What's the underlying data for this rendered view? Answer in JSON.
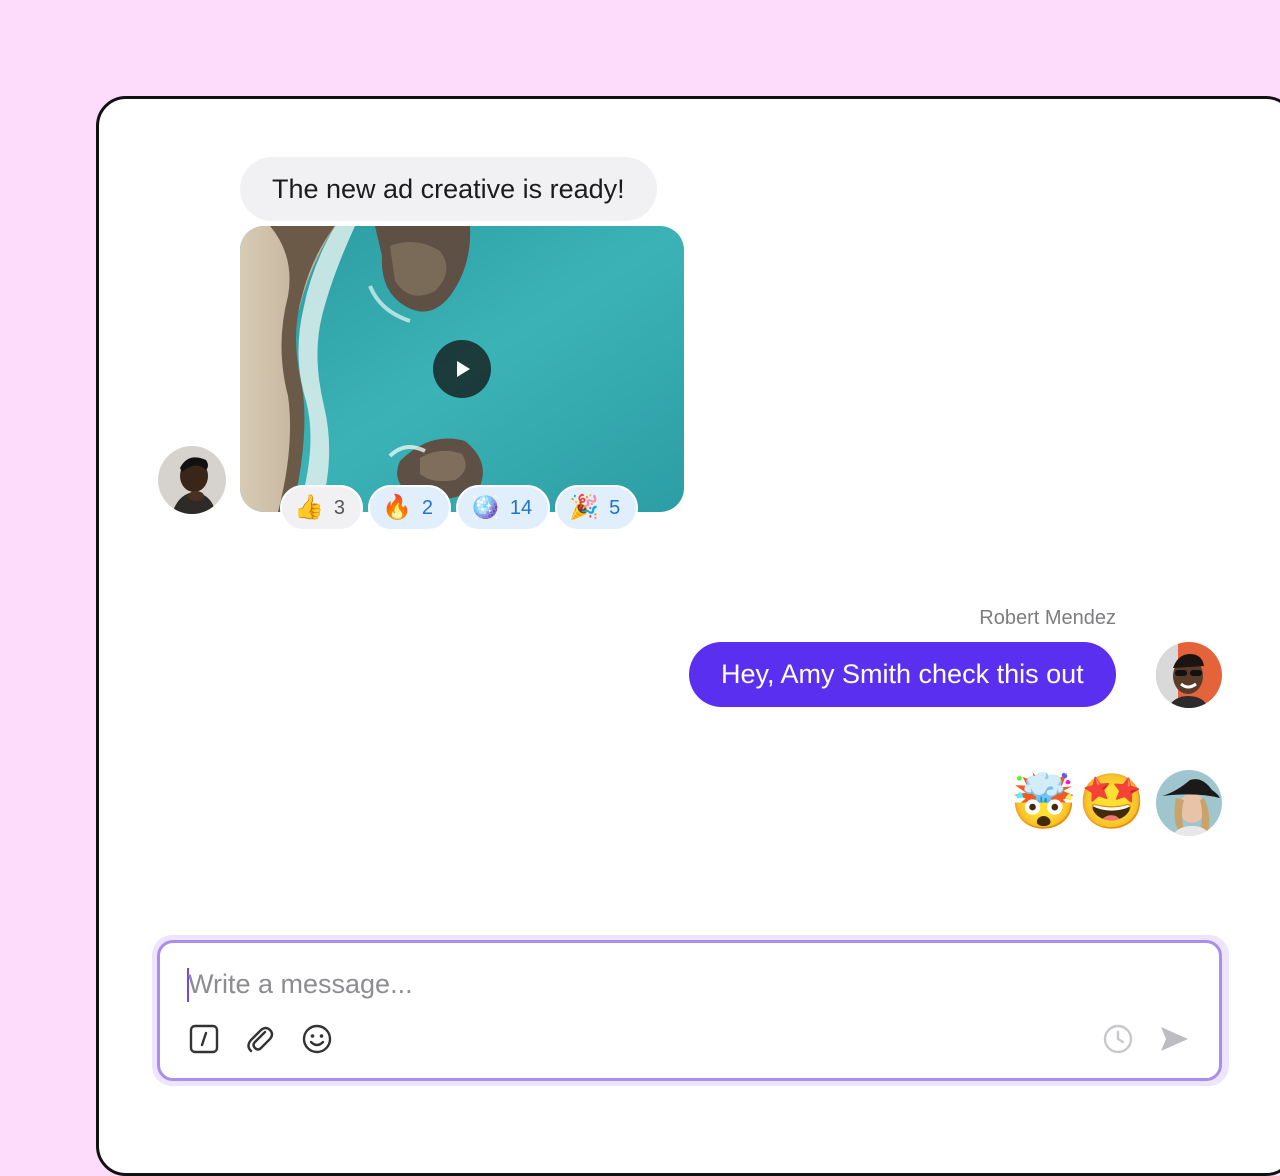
{
  "thread": {
    "message_1": {
      "text": "The new ad creative is ready!",
      "media": {
        "type": "video",
        "play_icon": "play-icon"
      },
      "reactions": [
        {
          "emoji": "👍",
          "icon": "thumbs-up-icon",
          "count": "3",
          "mine": false
        },
        {
          "emoji": "🔥",
          "icon": "fire-icon",
          "count": "2",
          "mine": true
        },
        {
          "emoji": "🪩",
          "icon": "disco-ball-icon",
          "count": "14",
          "mine": true
        },
        {
          "emoji": "🎉",
          "icon": "party-popper-icon",
          "count": "5",
          "mine": true
        }
      ]
    },
    "message_2": {
      "sender": "Robert Mendez",
      "text": "Hey, Amy Smith check this out"
    },
    "message_3": {
      "emojis": [
        "🤯",
        "🤩"
      ]
    }
  },
  "composer": {
    "placeholder": "Write a message...",
    "tools": [
      "slash-command-icon",
      "paperclip-icon",
      "emoji-icon"
    ],
    "actions": [
      "clock-icon",
      "send-icon"
    ]
  },
  "colors": {
    "page_background": "#fddcfb",
    "outgoing_bubble": "#5b2ff0",
    "incoming_bubble": "#f1f1f3",
    "composer_border": "#a98ef0",
    "reaction_mine_bg": "#e1eefb",
    "reaction_mine_text": "#1f73c9"
  }
}
